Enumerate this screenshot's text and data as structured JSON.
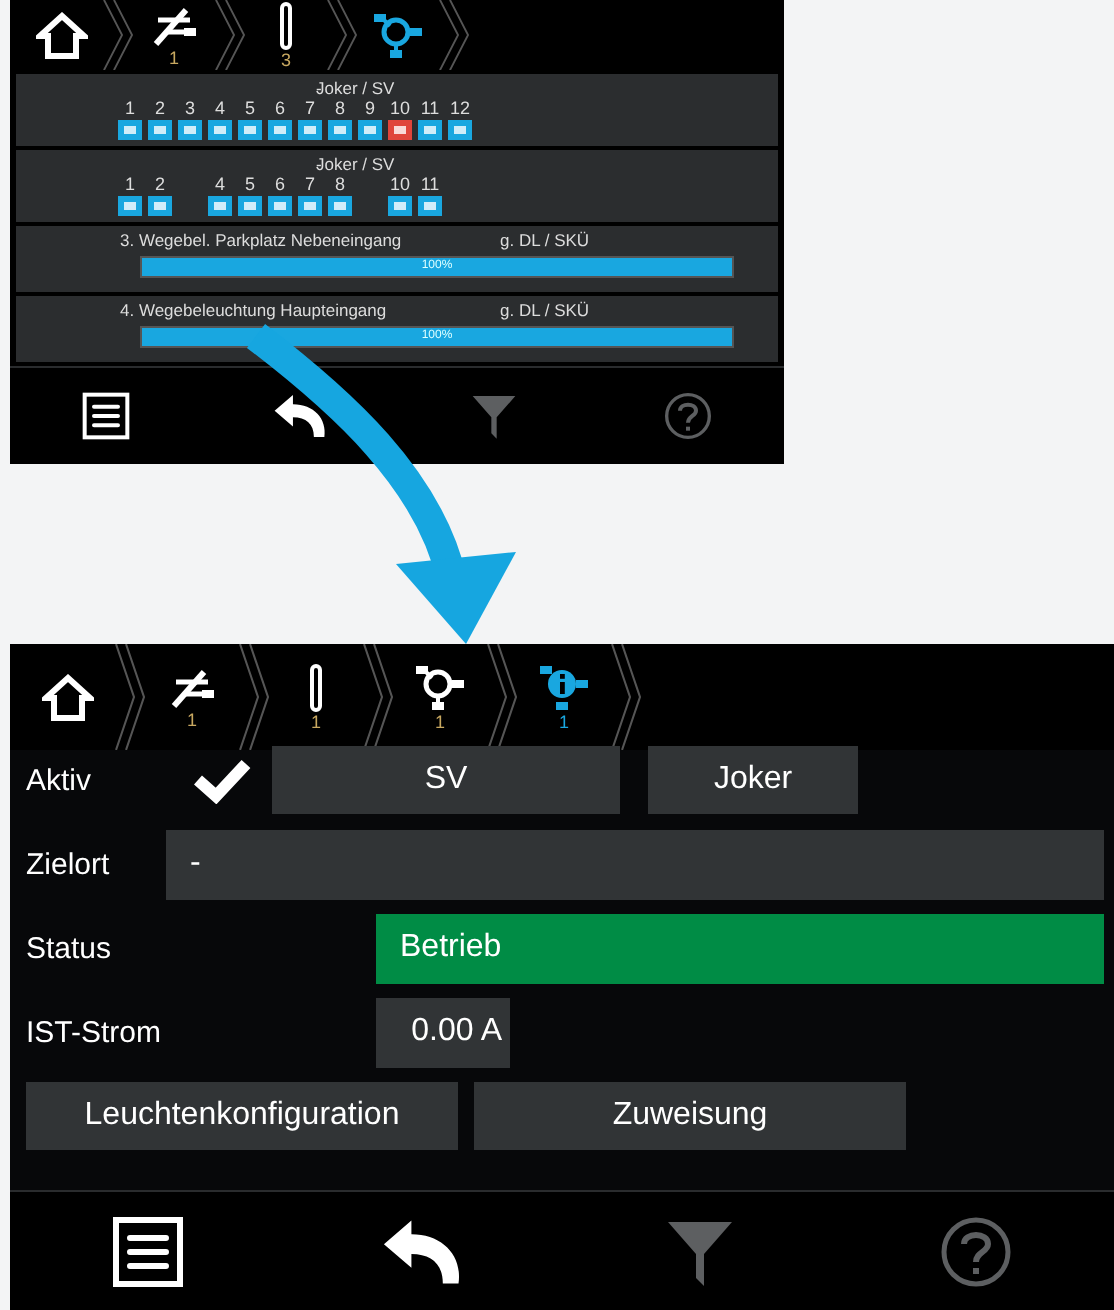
{
  "top_screen": {
    "breadcrumb": [
      {
        "kind": "home",
        "selected": false
      },
      {
        "kind": "cross",
        "count": "1",
        "selected": false
      },
      {
        "kind": "bar",
        "count": "3",
        "selected": false
      },
      {
        "kind": "node",
        "selected": true
      }
    ],
    "groups": [
      {
        "kind": "lamps",
        "title": "-",
        "type": "Joker / SV",
        "lamps": [
          {
            "kind": "lamp",
            "label": "1",
            "fault": false
          },
          {
            "kind": "lamp",
            "label": "2",
            "fault": false
          },
          {
            "kind": "lamp",
            "label": "3",
            "fault": false
          },
          {
            "kind": "lamp",
            "label": "4",
            "fault": false
          },
          {
            "kind": "lamp",
            "label": "5",
            "fault": false
          },
          {
            "kind": "lamp",
            "label": "6",
            "fault": false
          },
          {
            "kind": "lamp",
            "label": "7",
            "fault": false
          },
          {
            "kind": "lamp",
            "label": "8",
            "fault": false
          },
          {
            "kind": "lamp",
            "label": "9",
            "fault": false
          },
          {
            "kind": "lamp",
            "label": "10",
            "fault": true
          },
          {
            "kind": "lamp",
            "label": "11",
            "fault": false
          },
          {
            "kind": "lamp",
            "label": "12",
            "fault": false
          }
        ]
      },
      {
        "kind": "lamps",
        "title": "-",
        "type": "Joker / SV",
        "lamps": [
          {
            "kind": "lamp",
            "label": "1",
            "fault": false
          },
          {
            "kind": "lamp",
            "label": "2",
            "fault": false
          },
          {
            "kind": "gap"
          },
          {
            "kind": "lamp",
            "label": "4",
            "fault": false
          },
          {
            "kind": "lamp",
            "label": "5",
            "fault": false
          },
          {
            "kind": "lamp",
            "label": "6",
            "fault": false
          },
          {
            "kind": "lamp",
            "label": "7",
            "fault": false
          },
          {
            "kind": "lamp",
            "label": "8",
            "fault": false
          },
          {
            "kind": "gap"
          },
          {
            "kind": "lamp",
            "label": "10",
            "fault": false
          },
          {
            "kind": "lamp",
            "label": "11",
            "fault": false
          }
        ]
      },
      {
        "kind": "progress",
        "title": "3. Wegebel. Parkplatz Nebeneingang",
        "type": "g. DL / SKÜ",
        "level": 1,
        "reading": "100%"
      },
      {
        "kind": "progress",
        "title": "4. Wegebeleuchtung Haupteingang",
        "type": "g. DL / SKÜ",
        "level": 1,
        "reading": "100%"
      }
    ],
    "footer": [
      {
        "kind": "menu",
        "disabled": false
      },
      {
        "kind": "back",
        "disabled": false
      },
      {
        "kind": "filter",
        "disabled": true
      },
      {
        "kind": "help",
        "disabled": true
      }
    ]
  },
  "bottom_screen": {
    "breadcrumb": [
      {
        "kind": "home",
        "selected": false
      },
      {
        "kind": "cross",
        "count": "1",
        "selected": false
      },
      {
        "kind": "bar",
        "count": "1",
        "selected": false
      },
      {
        "kind": "node",
        "count": "1",
        "selected": false
      },
      {
        "kind": "info",
        "count": "1",
        "selected": true
      }
    ],
    "aktiv": {
      "label": "Aktiv",
      "checked": true
    },
    "mode_buttons": [
      "SV",
      "Joker"
    ],
    "zielort": {
      "label": "Zielort",
      "value": "-"
    },
    "status": {
      "label": "Status",
      "value": "Betrieb",
      "ok": true
    },
    "ist_strom": {
      "label": "IST-Strom",
      "value": "0.00 A"
    },
    "actions": [
      "Leuchtenkonfiguration",
      "Zuweisung"
    ],
    "footer": [
      {
        "kind": "menu",
        "disabled": false
      },
      {
        "kind": "back",
        "disabled": false
      },
      {
        "kind": "filter",
        "disabled": true
      },
      {
        "kind": "help",
        "disabled": true
      }
    ]
  }
}
